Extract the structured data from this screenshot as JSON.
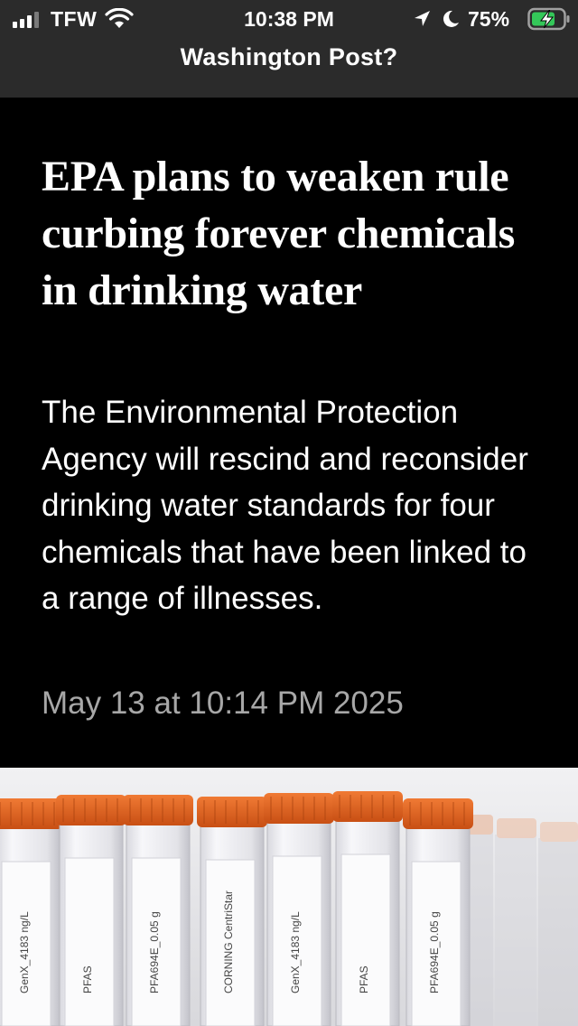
{
  "status_bar": {
    "carrier": "TFW",
    "time": "10:38 PM",
    "battery_percent": "75%",
    "signal_bars_filled": 3,
    "signal_bars_total": 4,
    "charging": true
  },
  "header": {
    "title": "Washington Post?"
  },
  "article": {
    "headline": "EPA plans to weaken rule curbing forever chemicals in drinking water",
    "summary": "The Environmental Protection Agency will rescind and reconsider drinking water standards for four chemicals that have been linked to a range of illnesses.",
    "dateline": "May 13 at 10:14 PM 2025"
  },
  "photo": {
    "tube_labels": [
      "GenX_4183 ng/L",
      "PFAS",
      "PFA694E_0.05 g",
      "CORNING CentriStar"
    ],
    "cap_color": "#e2611f"
  },
  "colors": {
    "background": "#000000",
    "header_bar": "#2b2b2b",
    "dateline": "#a7a7a7",
    "battery_charging": "#34c759"
  }
}
